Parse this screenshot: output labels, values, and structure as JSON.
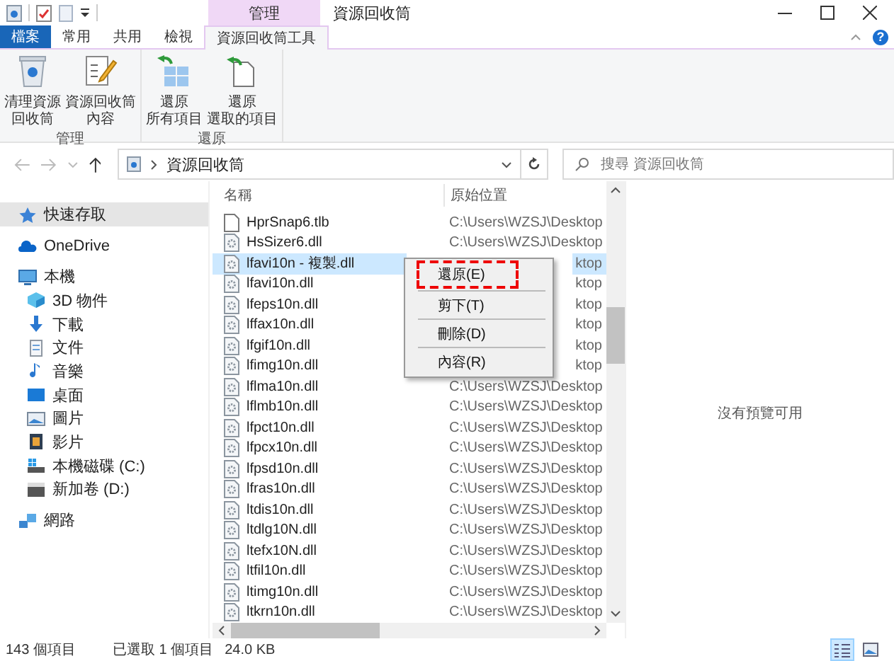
{
  "title_bar": {
    "contextual_tab": "管理",
    "title": "資源回收筒"
  },
  "ribbon_tabs": [
    {
      "label": "檔案",
      "kind": "file",
      "selected": false
    },
    {
      "label": "常用",
      "kind": "normal",
      "selected": false
    },
    {
      "label": "共用",
      "kind": "normal",
      "selected": false
    },
    {
      "label": "檢視",
      "kind": "normal",
      "selected": false
    },
    {
      "label": "資源回收筒工具",
      "kind": "contextual",
      "selected": true
    }
  ],
  "help_button": "?",
  "ribbon_groups": [
    {
      "label": "管理",
      "commands": [
        {
          "kind": "empty_bin",
          "lines": [
            "清理資源",
            "回收筒"
          ]
        },
        {
          "kind": "properties",
          "lines": [
            "資源回收筒",
            "內容"
          ]
        }
      ]
    },
    {
      "label": "還原",
      "commands": [
        {
          "kind": "restore_all",
          "lines": [
            "還原",
            "所有項目"
          ]
        },
        {
          "kind": "restore_selected",
          "lines": [
            "還原",
            "選取的項目"
          ]
        }
      ]
    }
  ],
  "address_bar": {
    "path": "資源回收筒"
  },
  "search": {
    "placeholder": "搜尋 資源回收筒"
  },
  "sidebar": {
    "items": [
      {
        "label": "快速存取",
        "kind": "star",
        "selected": true
      },
      {
        "label": "OneDrive",
        "kind": "cloud",
        "selected": false
      },
      {
        "label": "本機",
        "kind": "pc",
        "selected": false,
        "children": [
          {
            "label": "3D 物件",
            "kind": "cube",
            "selected": false
          },
          {
            "label": "下載",
            "kind": "download",
            "selected": false
          },
          {
            "label": "文件",
            "kind": "document",
            "selected": false
          },
          {
            "label": "音樂",
            "kind": "music",
            "selected": false
          },
          {
            "label": "桌面",
            "kind": "desktop",
            "selected": false
          },
          {
            "label": "圖片",
            "kind": "pictures",
            "selected": false
          },
          {
            "label": "影片",
            "kind": "video",
            "selected": false
          },
          {
            "label": "本機磁碟 (C:)",
            "kind": "system_drive",
            "selected": false
          },
          {
            "label": "新加卷 (D:)",
            "kind": "drive",
            "selected": false
          }
        ]
      },
      {
        "label": "網路",
        "kind": "network",
        "selected": false
      }
    ]
  },
  "file_list": {
    "columns": [
      "名稱",
      "原始位置"
    ],
    "rows": [
      {
        "name": "HprSnap6.tlb",
        "kind": "blank",
        "location": "C:\\Users\\WZSJ\\Desktop",
        "covered": false,
        "selected": false
      },
      {
        "name": "HsSizer6.dll",
        "kind": "dll",
        "location": "C:\\Users\\WZSJ\\Desktop",
        "covered": false,
        "selected": false
      },
      {
        "name": "lfavi10n - 複製.dll",
        "kind": "dll",
        "location": "ktop",
        "covered": true,
        "selected": true
      },
      {
        "name": "lfavi10n.dll",
        "kind": "dll",
        "location": "ktop",
        "covered": true,
        "selected": false
      },
      {
        "name": "lfeps10n.dll",
        "kind": "dll",
        "location": "ktop",
        "covered": true,
        "selected": false
      },
      {
        "name": "lffax10n.dll",
        "kind": "dll",
        "location": "ktop",
        "covered": true,
        "selected": false
      },
      {
        "name": "lfgif10n.dll",
        "kind": "dll",
        "location": "ktop",
        "covered": true,
        "selected": false
      },
      {
        "name": "lfimg10n.dll",
        "kind": "dll",
        "location": "ktop",
        "covered": true,
        "selected": false
      },
      {
        "name": "lflma10n.dll",
        "kind": "dll",
        "location": "C:\\Users\\WZSJ\\Desktop",
        "covered": false,
        "selected": false
      },
      {
        "name": "lflmb10n.dll",
        "kind": "dll",
        "location": "C:\\Users\\WZSJ\\Desktop",
        "covered": false,
        "selected": false
      },
      {
        "name": "lfpct10n.dll",
        "kind": "dll",
        "location": "C:\\Users\\WZSJ\\Desktop",
        "covered": false,
        "selected": false
      },
      {
        "name": "lfpcx10n.dll",
        "kind": "dll",
        "location": "C:\\Users\\WZSJ\\Desktop",
        "covered": false,
        "selected": false
      },
      {
        "name": "lfpsd10n.dll",
        "kind": "dll",
        "location": "C:\\Users\\WZSJ\\Desktop",
        "covered": false,
        "selected": false
      },
      {
        "name": "lfras10n.dll",
        "kind": "dll",
        "location": "C:\\Users\\WZSJ\\Desktop",
        "covered": false,
        "selected": false
      },
      {
        "name": "ltdis10n.dll",
        "kind": "dll",
        "location": "C:\\Users\\WZSJ\\Desktop",
        "covered": false,
        "selected": false
      },
      {
        "name": "ltdlg10N.dll",
        "kind": "dll",
        "location": "C:\\Users\\WZSJ\\Desktop",
        "covered": false,
        "selected": false
      },
      {
        "name": "ltefx10N.dll",
        "kind": "dll",
        "location": "C:\\Users\\WZSJ\\Desktop",
        "covered": false,
        "selected": false
      },
      {
        "name": "ltfil10n.dll",
        "kind": "dll",
        "location": "C:\\Users\\WZSJ\\Desktop",
        "covered": false,
        "selected": false
      },
      {
        "name": "ltimg10n.dll",
        "kind": "dll",
        "location": "C:\\Users\\WZSJ\\Desktop",
        "covered": false,
        "selected": false
      },
      {
        "name": "ltkrn10n.dll",
        "kind": "dll",
        "location": "C:\\Users\\WZSJ\\Desktop",
        "covered": false,
        "selected": false
      }
    ]
  },
  "context_menu": {
    "items": [
      {
        "label": "還原(E)",
        "annotated": true
      },
      {
        "label": "剪下(T)",
        "annotated": false
      },
      {
        "label": "刪除(D)",
        "annotated": false
      },
      {
        "label": "內容(R)",
        "annotated": false
      }
    ]
  },
  "preview": {
    "message": "沒有預覽可用"
  },
  "status_bar": {
    "item_count": "143 個項目",
    "selection": "已選取 1 個項目",
    "size": "24.0 KB"
  },
  "view_buttons": [
    {
      "kind": "details",
      "selected": true
    },
    {
      "kind": "large_icons",
      "selected": false
    }
  ]
}
